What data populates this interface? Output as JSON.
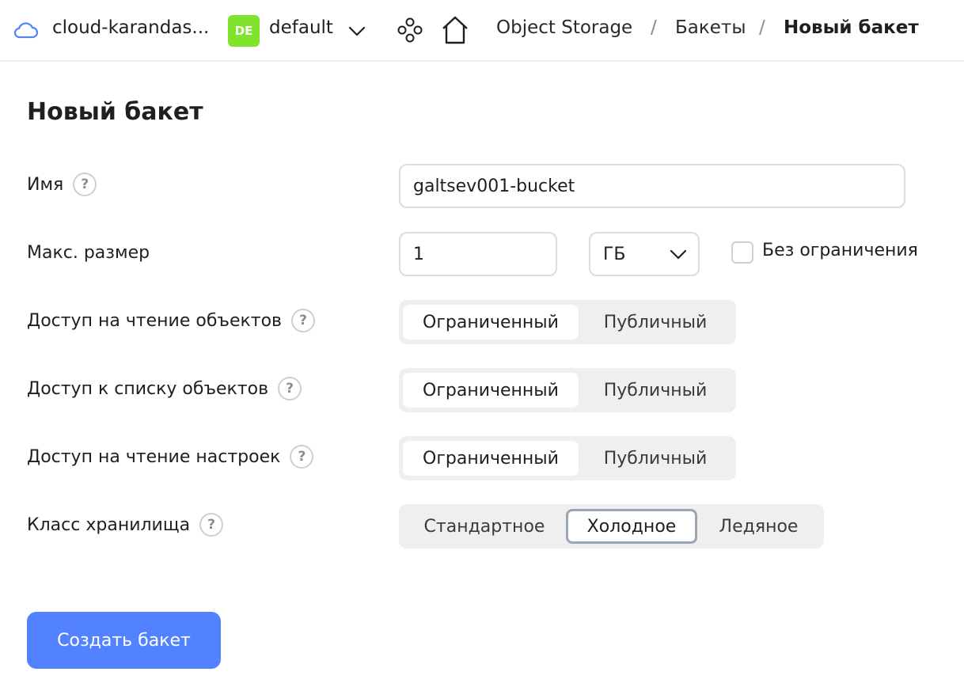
{
  "header": {
    "cloud_name": "cloud-karandas...",
    "folder_badge": "DE",
    "folder_name": "default",
    "breadcrumbs": [
      "Object Storage",
      "Бакеты",
      "Новый бакет"
    ],
    "separator": "/"
  },
  "page": {
    "title": "Новый бакет"
  },
  "form": {
    "name": {
      "label": "Имя",
      "value": "galtsev001-bucket",
      "help": "?"
    },
    "max_size": {
      "label": "Макс. размер",
      "value": "1",
      "unit": "ГБ",
      "unlimited_label": "Без ограничения",
      "unlimited_checked": false
    },
    "read_objects": {
      "label": "Доступ на чтение объектов",
      "options": [
        "Ограниченный",
        "Публичный"
      ],
      "selected": "Ограниченный"
    },
    "list_objects": {
      "label": "Доступ к списку объектов",
      "options": [
        "Ограниченный",
        "Публичный"
      ],
      "selected": "Ограниченный"
    },
    "read_settings": {
      "label": "Доступ на чтение настроек",
      "options": [
        "Ограниченный",
        "Публичный"
      ],
      "selected": "Ограниченный"
    },
    "storage_class": {
      "label": "Класс хранилища",
      "options": [
        "Стандартное",
        "Холодное",
        "Ледяное"
      ],
      "selected": "Холодное"
    },
    "help_glyph": "?"
  },
  "actions": {
    "create_label": "Создать бакет"
  },
  "colors": {
    "primary": "#5282ff",
    "badge": "#7ee32a",
    "cloud_icon": "#5282ff"
  }
}
